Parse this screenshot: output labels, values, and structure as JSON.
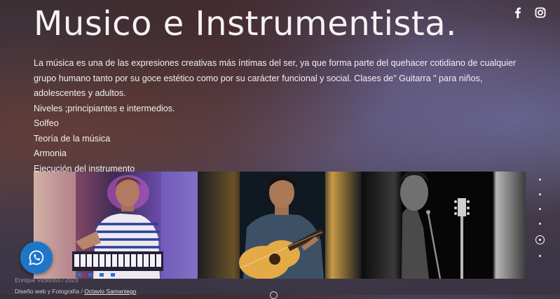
{
  "page": {
    "title": "Musico e Instrumentista.",
    "description": [
      "La música es una de las expresiones creativas más íntimas del ser, ya que forma parte del quehacer cotidiano de cualquier grupo humano tanto por su goce estético como por su carácter funcional y social. Clases de\" Guitarra \" para niños, adolescentes y adultos.",
      "Niveles ;principiantes e intermedios.",
      "Solfeo",
      "Teoría de la música",
      "Armonia",
      "Ejecución del instrumento"
    ]
  },
  "social": {
    "icons": [
      "facebook-icon",
      "instagram-icon"
    ]
  },
  "gallery": {
    "slides": [
      {
        "subject": "keyboard-player"
      },
      {
        "subject": "guitar-player"
      },
      {
        "subject": "guitar-player-bw"
      }
    ],
    "pagination": {
      "count": 6,
      "active": 5
    }
  },
  "whatsapp": {
    "icon": "whatsapp-icon",
    "color": "#1e76c9"
  },
  "footer": {
    "copyright": "Enrique Victorino / 2023",
    "credit_prefix": "Diseño web y Fotografía / ",
    "credit_name": "Octavio Samaniego"
  }
}
